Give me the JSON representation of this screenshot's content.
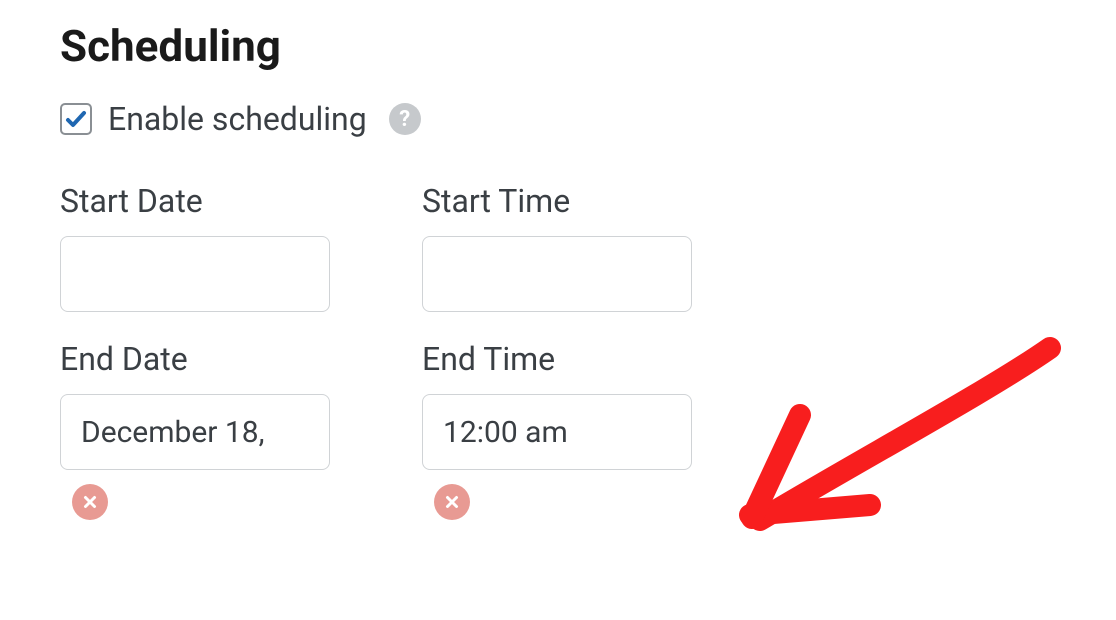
{
  "section": {
    "title": "Scheduling",
    "checkbox_label": "Enable scheduling",
    "checkbox_checked": true
  },
  "fields": {
    "start_date": {
      "label": "Start Date",
      "value": ""
    },
    "start_time": {
      "label": "Start Time",
      "value": ""
    },
    "end_date": {
      "label": "End Date",
      "value": "December 18,"
    },
    "end_time": {
      "label": "End Time",
      "value": "12:00 am"
    }
  },
  "annotation": {
    "arrow_color": "#f81e1e"
  }
}
